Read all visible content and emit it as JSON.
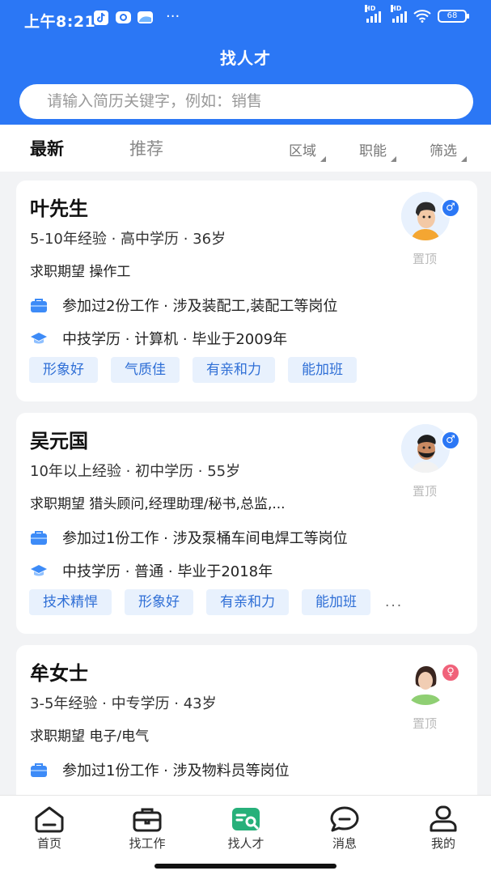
{
  "status_bar": {
    "time": "上午8:21",
    "more": "···",
    "battery": "68",
    "hd": "HD"
  },
  "header": {
    "title": "找人才"
  },
  "search": {
    "placeholder": "请输入简历关键字，例如：销售"
  },
  "tabs": [
    {
      "label": "最新",
      "active": true
    },
    {
      "label": "推荐",
      "active": false
    }
  ],
  "filters": [
    {
      "label": "区域"
    },
    {
      "label": "职能"
    },
    {
      "label": "筛选"
    }
  ],
  "candidates": [
    {
      "name": "叶先生",
      "meta": "5-10年经验 · 高中学历 · 36岁",
      "desire": "求职期望 操作工",
      "work": "参加过2份工作 · 涉及装配工,装配工等岗位",
      "education": "中技学历 · 计算机 · 毕业于2009年",
      "tags": [
        "形象好",
        "气质佳",
        "有亲和力",
        "能加班"
      ],
      "more": "",
      "gender": "male",
      "pin": "置顶"
    },
    {
      "name": "吴元国",
      "meta": "10年以上经验 · 初中学历 · 55岁",
      "desire": "求职期望 猎头顾问,经理助理/秘书,总监,...",
      "work": "参加过1份工作 · 涉及泵桶车间电焊工等岗位",
      "education": "中技学历 · 普通 · 毕业于2018年",
      "tags": [
        "技术精悍",
        "形象好",
        "有亲和力",
        "能加班"
      ],
      "more": "...",
      "gender": "male",
      "pin": "置顶"
    },
    {
      "name": "牟女士",
      "meta": "3-5年经验 · 中专学历 · 43岁",
      "desire": "求职期望 电子/电气",
      "work": "参加过1份工作 · 涉及物料员等岗位",
      "gender": "female",
      "pin": "置顶"
    }
  ],
  "bottom_nav": [
    {
      "label": "首页",
      "icon": "home-icon"
    },
    {
      "label": "找工作",
      "icon": "briefcase-icon"
    },
    {
      "label": "找人才",
      "icon": "talent-search-icon",
      "active": true
    },
    {
      "label": "消息",
      "icon": "message-icon"
    },
    {
      "label": "我的",
      "icon": "profile-icon"
    }
  ],
  "colors": {
    "primary": "#2b77f5",
    "male": "#2b77f5",
    "female": "#f0627a",
    "tag_bg": "#e8f1fd",
    "tag_text": "#2f6fd6"
  }
}
